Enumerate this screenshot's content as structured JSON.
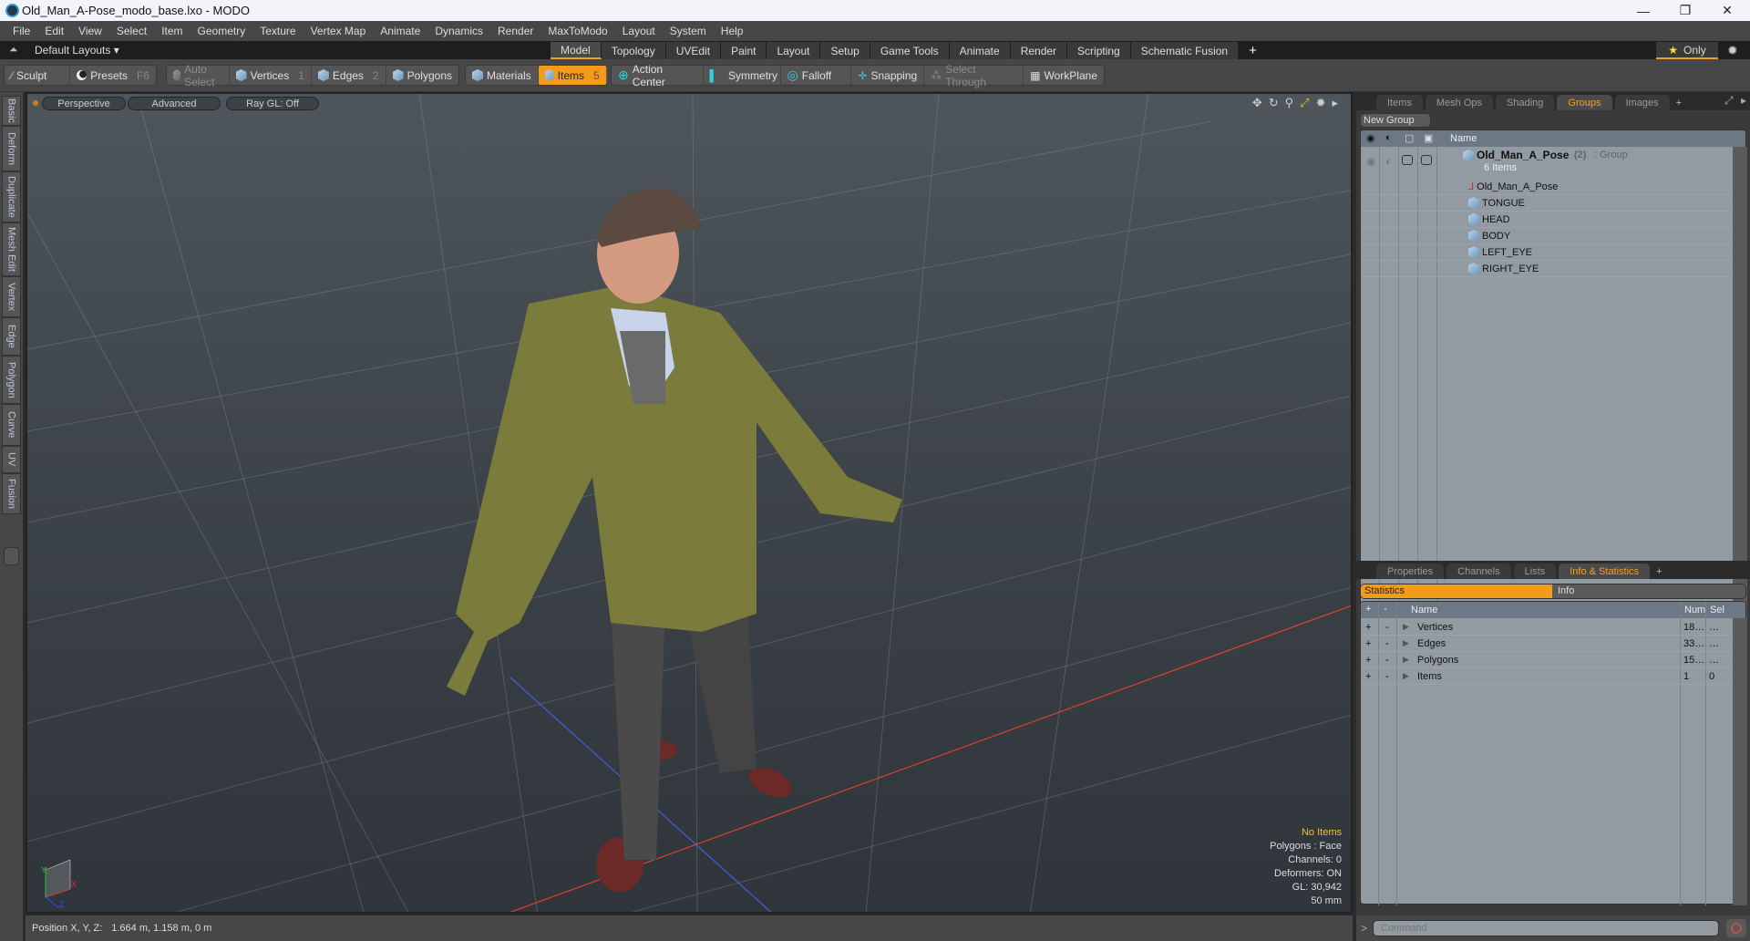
{
  "window": {
    "title": "Old_Man_A-Pose_modo_base.lxo - MODO",
    "controls": {
      "minimize": "—",
      "maximize": "❐",
      "close": "✕"
    }
  },
  "menu": [
    "File",
    "Edit",
    "View",
    "Select",
    "Item",
    "Geometry",
    "Texture",
    "Vertex Map",
    "Animate",
    "Dynamics",
    "Render",
    "MaxToModo",
    "Layout",
    "System",
    "Help"
  ],
  "layout_bar": {
    "layout_label": "Default Layouts ▾",
    "tabs": [
      "Model",
      "Topology",
      "UVEdit",
      "Paint",
      "Layout",
      "Setup",
      "Game Tools",
      "Animate",
      "Render",
      "Scripting",
      "Schematic Fusion"
    ],
    "active_tab": "Model",
    "add": "+",
    "only_label": "Only",
    "star": "★"
  },
  "toolbar": {
    "sculpt": "Sculpt",
    "presets": "Presets",
    "presets_key": "F6",
    "auto_select": "Auto Select",
    "vertices": "Vertices",
    "vertices_key": "1",
    "edges": "Edges",
    "edges_key": "2",
    "polygons": "Polygons",
    "materials": "Materials",
    "items": "Items",
    "items_key": "5",
    "action_center": "Action Center",
    "symmetry": "Symmetry",
    "falloff": "Falloff",
    "snapping": "Snapping",
    "select_through": "Select Through",
    "workplane": "WorkPlane"
  },
  "left_tabs": [
    "Basic",
    "Deform",
    "Duplicate",
    "Mesh Edit",
    "Vertex",
    "Edge",
    "Polygon",
    "Curve",
    "UV",
    "Fusion"
  ],
  "viewport": {
    "view_mode": "Perspective",
    "shading": "Advanced",
    "raygl": "Ray GL: Off",
    "info": {
      "selection": "No Items",
      "polygons": "Polygons : Face",
      "channels": "Channels: 0",
      "deformers": "Deformers: ON",
      "gl": "GL: 30,942",
      "focal": "50 mm"
    },
    "axis": {
      "x": "X",
      "y": "Y",
      "z": "Z"
    }
  },
  "status": {
    "position_label": "Position X, Y, Z:",
    "position_value": "1.664 m, 1.158 m, 0 m"
  },
  "groups_panel": {
    "tabs": [
      "Items",
      "Mesh Ops",
      "Shading",
      "Groups",
      "Images"
    ],
    "active_tab": "Groups",
    "new_group": "New Group",
    "column_name": "Name",
    "group": {
      "name": "Old_Man_A_Pose",
      "count": "(2)",
      "type": ": Group",
      "sub": "6 Items"
    },
    "children": [
      "Old_Man_A_Pose",
      "TONGUE",
      "HEAD",
      "BODY",
      "LEFT_EYE",
      "RIGHT_EYE"
    ]
  },
  "info_panel": {
    "tabs": [
      "Properties",
      "Channels",
      "Lists",
      "Info & Statistics"
    ],
    "active_tab": "Info & Statistics",
    "subtabs": [
      "Statistics",
      "Info"
    ],
    "columns": {
      "plus": "+",
      "minus": "-",
      "name": "Name",
      "num": "Num",
      "sel": "Sel"
    },
    "rows": [
      {
        "name": "Vertices",
        "num": "18…",
        "sel": "…"
      },
      {
        "name": "Edges",
        "num": "33…",
        "sel": "…"
      },
      {
        "name": "Polygons",
        "num": "15…",
        "sel": "…"
      },
      {
        "name": "Items",
        "num": "1",
        "sel": "0"
      }
    ]
  },
  "command": {
    "prompt": ">",
    "placeholder": "Command"
  },
  "colors": {
    "accent": "#f39c1b",
    "viewport_top": "#4e565c",
    "panel_bg": "#929aa2"
  }
}
